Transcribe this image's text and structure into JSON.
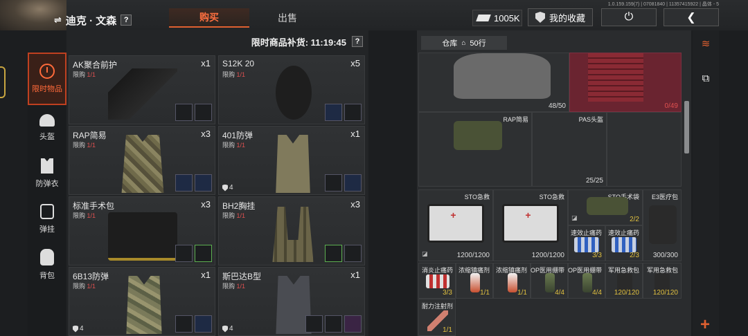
{
  "header": {
    "player_name": "迪克 · 文森",
    "help": "?",
    "tabs": [
      {
        "label": "购买"
      },
      {
        "label": "出售"
      }
    ],
    "version": "1.0.159.159(7) | 07081840 | 11357415922 | 晶体 - 5",
    "money": "1005K",
    "favorites_label": "我的收藏"
  },
  "nav": [
    {
      "label": "限时物品",
      "icon": "clock-icon"
    },
    {
      "label": "头盔",
      "icon": "helmet-icon"
    },
    {
      "label": "防弹衣",
      "icon": "vest-icon"
    },
    {
      "label": "弹挂",
      "icon": "chest-rig-icon"
    },
    {
      "label": "背包",
      "icon": "backpack-icon"
    }
  ],
  "shop": {
    "restock_label": "限时商品补货: 11:19:45",
    "help": "?",
    "limit_prefix": "限购",
    "items": [
      {
        "name": "AK聚合前护",
        "qty": "x1",
        "limit": "1/1"
      },
      {
        "name": "S12K 20",
        "qty": "x5",
        "limit": "1/1"
      },
      {
        "name": "RAP简易",
        "qty": "x3",
        "limit": "1/1"
      },
      {
        "name": "401防弹",
        "qty": "x1",
        "limit": "1/1",
        "armor": "4"
      },
      {
        "name": "标准手术包",
        "qty": "x3",
        "limit": "1/1"
      },
      {
        "name": "BH2胸挂",
        "qty": "x3",
        "limit": "1/1"
      },
      {
        "name": "6B13防弹",
        "qty": "x1",
        "limit": "1/1",
        "armor": "4"
      },
      {
        "name": "斯巴达B型",
        "qty": "x1",
        "limit": "1/1",
        "armor": "4"
      }
    ]
  },
  "warehouse": {
    "label": "仓库",
    "rows": "50行",
    "cells": [
      {
        "count": "48/50"
      },
      {
        "count": "0/49"
      },
      {
        "name": "RAP简易"
      },
      {
        "name": "PAS头盔",
        "count": "25/25"
      },
      {
        "name": "STO急救",
        "count": "1200/1200"
      },
      {
        "name": "STO急救",
        "count": "1200/1200"
      },
      {
        "name": "STO手术袋",
        "count": "2/2"
      },
      {
        "name": "E3医疗包",
        "count": "300/300"
      },
      {
        "name": "速效止痛药",
        "count": "3/3"
      },
      {
        "name": "速效止痛药",
        "count": "2/3"
      },
      {
        "name": "消炎止痛药",
        "count": "3/3"
      },
      {
        "name": "浓缩镇痛剂",
        "count": "1/1"
      },
      {
        "name": "浓缩镇痛剂",
        "count": "1/1"
      },
      {
        "name": "OP医用绷带",
        "count": "4/4"
      },
      {
        "name": "OP医用绷带",
        "count": "4/4"
      },
      {
        "name": "军用急救包",
        "count": "120/120"
      },
      {
        "name": "军用急救包",
        "count": "120/120"
      },
      {
        "name": "耐力注射剂",
        "count": "1/1"
      }
    ]
  },
  "colors": {
    "accent": "#e06030",
    "limit_red": "#e05050"
  }
}
